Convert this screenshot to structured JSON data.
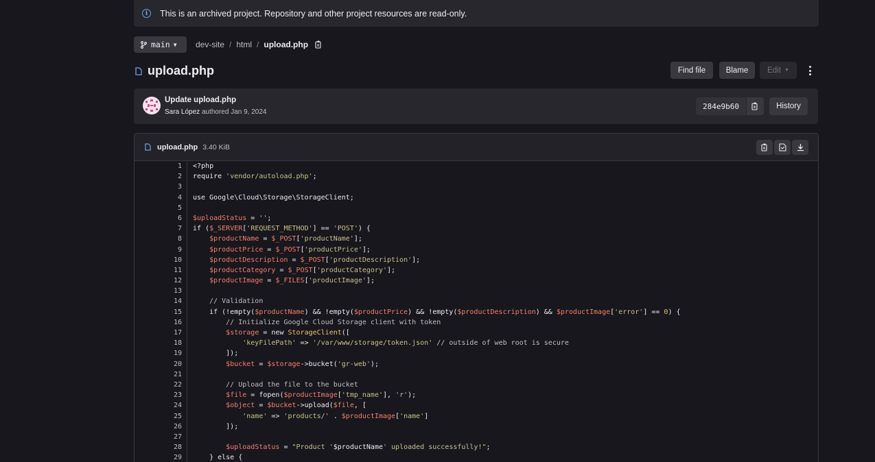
{
  "banner": {
    "text": "This is an archived project. Repository and other project resources are read-only."
  },
  "branch": {
    "name": "main"
  },
  "breadcrumb": {
    "items": [
      "dev-site",
      "html"
    ],
    "current": "upload.php"
  },
  "file": {
    "title": "upload.php",
    "name": "upload.php",
    "size": "3.40 KiB"
  },
  "actions": {
    "find_file": "Find file",
    "blame": "Blame",
    "edit": "Edit"
  },
  "commit": {
    "message": "Update upload.php",
    "author": "Sara López",
    "authored": "authored Jan 9, 2024",
    "sha": "284e9b60",
    "history": "History"
  },
  "code": [
    [
      {
        "t": "<?php",
        "c": "k"
      }
    ],
    [
      {
        "t": "require ",
        "c": "k"
      },
      {
        "t": "'vendor/autoload.php'",
        "c": "s"
      },
      {
        "t": ";",
        "c": "k"
      }
    ],
    [],
    [
      {
        "t": "use Google\\Cloud\\Storage\\StorageClient;",
        "c": "k"
      }
    ],
    [],
    [
      {
        "t": "$uploadStatus",
        "c": "v"
      },
      {
        "t": " = ",
        "c": "k"
      },
      {
        "t": "''",
        "c": "s"
      },
      {
        "t": ";",
        "c": "k"
      }
    ],
    [
      {
        "t": "if (",
        "c": "k"
      },
      {
        "t": "$_SERVER",
        "c": "v"
      },
      {
        "t": "[",
        "c": "k"
      },
      {
        "t": "'REQUEST_METHOD'",
        "c": "s"
      },
      {
        "t": "] == ",
        "c": "k"
      },
      {
        "t": "'POST'",
        "c": "s"
      },
      {
        "t": ") {",
        "c": "k"
      }
    ],
    [
      {
        "t": "    ",
        "c": "k"
      },
      {
        "t": "$productName",
        "c": "v"
      },
      {
        "t": " = ",
        "c": "k"
      },
      {
        "t": "$_POST",
        "c": "v"
      },
      {
        "t": "[",
        "c": "k"
      },
      {
        "t": "'productName'",
        "c": "s"
      },
      {
        "t": "];",
        "c": "k"
      }
    ],
    [
      {
        "t": "    ",
        "c": "k"
      },
      {
        "t": "$productPrice",
        "c": "v"
      },
      {
        "t": " = ",
        "c": "k"
      },
      {
        "t": "$_POST",
        "c": "v"
      },
      {
        "t": "[",
        "c": "k"
      },
      {
        "t": "'productPrice'",
        "c": "s"
      },
      {
        "t": "];",
        "c": "k"
      }
    ],
    [
      {
        "t": "    ",
        "c": "k"
      },
      {
        "t": "$productDescription",
        "c": "v"
      },
      {
        "t": " = ",
        "c": "k"
      },
      {
        "t": "$_POST",
        "c": "v"
      },
      {
        "t": "[",
        "c": "k"
      },
      {
        "t": "'productDescription'",
        "c": "s"
      },
      {
        "t": "];",
        "c": "k"
      }
    ],
    [
      {
        "t": "    ",
        "c": "k"
      },
      {
        "t": "$productCategory",
        "c": "v"
      },
      {
        "t": " = ",
        "c": "k"
      },
      {
        "t": "$_POST",
        "c": "v"
      },
      {
        "t": "[",
        "c": "k"
      },
      {
        "t": "'productCategory'",
        "c": "s"
      },
      {
        "t": "];",
        "c": "k"
      }
    ],
    [
      {
        "t": "    ",
        "c": "k"
      },
      {
        "t": "$productImage",
        "c": "v"
      },
      {
        "t": " = ",
        "c": "k"
      },
      {
        "t": "$_FILES",
        "c": "v"
      },
      {
        "t": "[",
        "c": "k"
      },
      {
        "t": "'productImage'",
        "c": "s"
      },
      {
        "t": "];",
        "c": "k"
      }
    ],
    [],
    [
      {
        "t": "    // Validation",
        "c": "c"
      }
    ],
    [
      {
        "t": "    if (!empty(",
        "c": "k"
      },
      {
        "t": "$productName",
        "c": "v"
      },
      {
        "t": ") && !empty(",
        "c": "k"
      },
      {
        "t": "$productPrice",
        "c": "v"
      },
      {
        "t": ") && !empty(",
        "c": "k"
      },
      {
        "t": "$productDescription",
        "c": "v"
      },
      {
        "t": ") && ",
        "c": "k"
      },
      {
        "t": "$productImage",
        "c": "v"
      },
      {
        "t": "[",
        "c": "k"
      },
      {
        "t": "'error'",
        "c": "s"
      },
      {
        "t": "] == ",
        "c": "k"
      },
      {
        "t": "0",
        "c": "n"
      },
      {
        "t": ") {",
        "c": "k"
      }
    ],
    [
      {
        "t": "        // Initialize Google Cloud Storage client with token",
        "c": "c"
      }
    ],
    [
      {
        "t": "        ",
        "c": "k"
      },
      {
        "t": "$storage",
        "c": "v"
      },
      {
        "t": " = new ",
        "c": "k"
      },
      {
        "t": "StorageClient",
        "c": "y"
      },
      {
        "t": "([",
        "c": "k"
      }
    ],
    [
      {
        "t": "            ",
        "c": "k"
      },
      {
        "t": "'keyFilePath'",
        "c": "s"
      },
      {
        "t": " => ",
        "c": "k"
      },
      {
        "t": "'/var/www/storage/token.json'",
        "c": "s"
      },
      {
        "t": " // outside of web root is secure",
        "c": "c"
      }
    ],
    [
      {
        "t": "        ]);",
        "c": "k"
      }
    ],
    [
      {
        "t": "        ",
        "c": "k"
      },
      {
        "t": "$bucket",
        "c": "v"
      },
      {
        "t": " = ",
        "c": "k"
      },
      {
        "t": "$storage",
        "c": "v"
      },
      {
        "t": "->bucket(",
        "c": "k"
      },
      {
        "t": "'gr-web'",
        "c": "s"
      },
      {
        "t": ");",
        "c": "k"
      }
    ],
    [],
    [
      {
        "t": "        // Upload the file to the bucket",
        "c": "c"
      }
    ],
    [
      {
        "t": "        ",
        "c": "k"
      },
      {
        "t": "$file",
        "c": "v"
      },
      {
        "t": " = fopen(",
        "c": "k"
      },
      {
        "t": "$productImage",
        "c": "v"
      },
      {
        "t": "[",
        "c": "k"
      },
      {
        "t": "'tmp_name'",
        "c": "s"
      },
      {
        "t": "], ",
        "c": "k"
      },
      {
        "t": "'r'",
        "c": "s"
      },
      {
        "t": ");",
        "c": "k"
      }
    ],
    [
      {
        "t": "        ",
        "c": "k"
      },
      {
        "t": "$object",
        "c": "v"
      },
      {
        "t": " = ",
        "c": "k"
      },
      {
        "t": "$bucket",
        "c": "v"
      },
      {
        "t": "->upload(",
        "c": "k"
      },
      {
        "t": "$file",
        "c": "v"
      },
      {
        "t": ", [",
        "c": "k"
      }
    ],
    [
      {
        "t": "            ",
        "c": "k"
      },
      {
        "t": "'name'",
        "c": "s"
      },
      {
        "t": " => ",
        "c": "k"
      },
      {
        "t": "'products/'",
        "c": "s"
      },
      {
        "t": " . ",
        "c": "k"
      },
      {
        "t": "$productImage",
        "c": "v"
      },
      {
        "t": "[",
        "c": "k"
      },
      {
        "t": "'name'",
        "c": "s"
      },
      {
        "t": "]",
        "c": "k"
      }
    ],
    [
      {
        "t": "        ]);",
        "c": "k"
      }
    ],
    [],
    [
      {
        "t": "        ",
        "c": "k"
      },
      {
        "t": "$uploadStatus",
        "c": "v"
      },
      {
        "t": " = ",
        "c": "k"
      },
      {
        "t": "\"Product '",
        "c": "s"
      },
      {
        "t": "$productName",
        "c": "k"
      },
      {
        "t": "' uploaded successfully!\"",
        "c": "s"
      },
      {
        "t": ";",
        "c": "k"
      }
    ],
    [
      {
        "t": "    } else {",
        "c": "k"
      }
    ]
  ]
}
